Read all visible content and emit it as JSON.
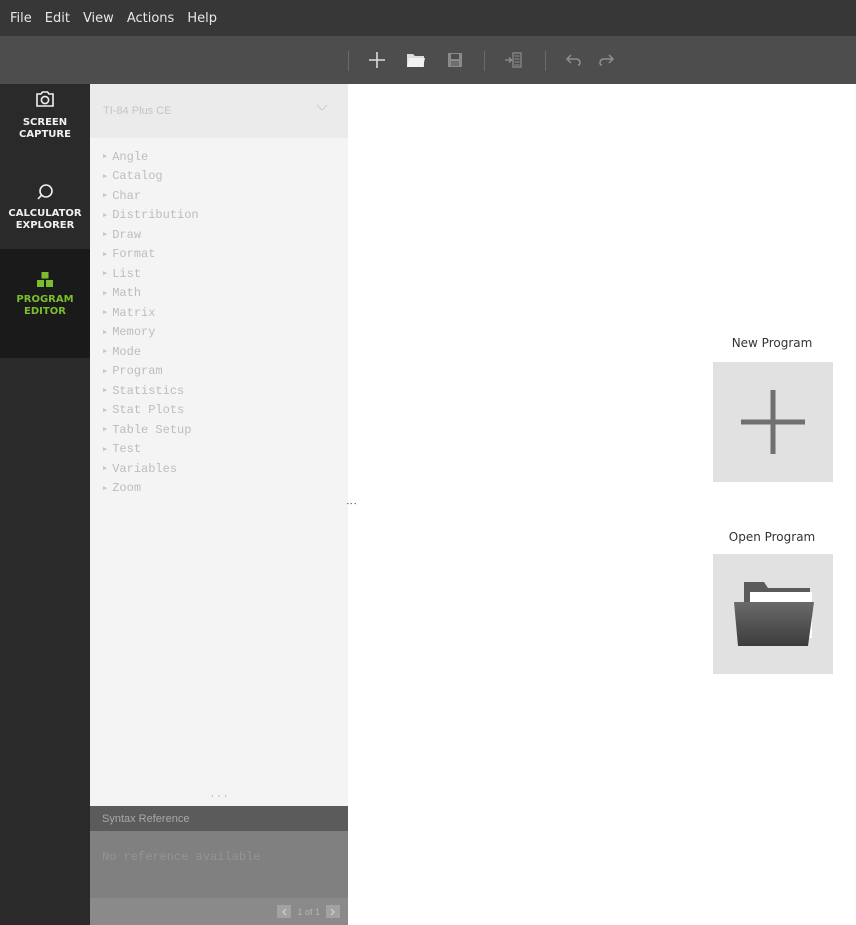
{
  "menu": [
    "File",
    "Edit",
    "View",
    "Actions",
    "Help"
  ],
  "toolbar": {
    "buttons": [
      "plus-icon",
      "folder-open-icon",
      "save-icon",
      "send-to-calculator-icon",
      "undo-icon",
      "redo-icon"
    ]
  },
  "nav": {
    "screen_capture": "SCREEN\nCAPTURE",
    "screen_capture_l1": "SCREEN",
    "screen_capture_l2": "CAPTURE",
    "calculator_explorer_l1": "CALCULATOR",
    "calculator_explorer_l2": "EXPLORER",
    "program_editor_l1": "PROGRAM",
    "program_editor_l2": "EDITOR",
    "active": "program_editor"
  },
  "catalog": {
    "calculator": "TI-84 Plus CE",
    "items": [
      "Angle",
      "Catalog",
      "Char",
      "Distribution",
      "Draw",
      "Format",
      "List",
      "Math",
      "Matrix",
      "Memory",
      "Mode",
      "Program",
      "Statistics",
      "Stat Plots",
      "Table Setup",
      "Test",
      "Variables",
      "Zoom"
    ]
  },
  "syntax": {
    "title": "Syntax Reference",
    "message": "No reference available",
    "pager": "1 of 1"
  },
  "main": {
    "new_program": "New Program",
    "open_program": "Open Program"
  },
  "colors": {
    "menubar": "#373737",
    "toolbar": "#4d4d4d",
    "nav": "#2a2a2a",
    "accent": "#7cbd2c",
    "tile": "#e1e1e1"
  }
}
